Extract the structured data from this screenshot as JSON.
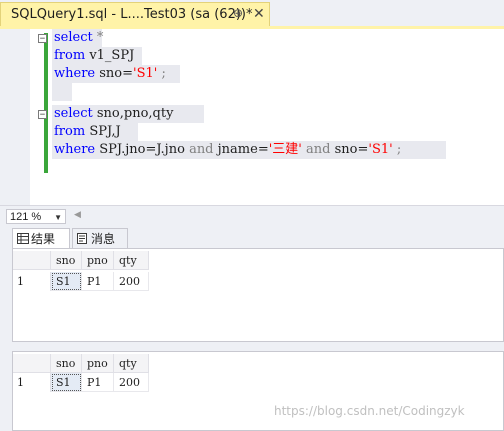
{
  "tab": {
    "title": "SQLQuery1.sql - L....Test03 (sa (62))*",
    "pin_glyph": "⊕",
    "close_glyph": "✕"
  },
  "editor": {
    "lines": [
      {
        "parts": [
          "select",
          " *"
        ]
      },
      {
        "parts": [
          "from",
          " v1_SPJ"
        ]
      },
      {
        "parts": [
          "where",
          " sno=",
          "'S1'",
          " ;"
        ]
      },
      {
        "parts": [
          "select",
          " sno,pno,qty"
        ]
      },
      {
        "parts": [
          "from",
          " SPJ,J"
        ]
      },
      {
        "parts": [
          "where",
          " SPJ.jno=J.jno ",
          "and",
          " jname=",
          "'三建'",
          " ",
          "and",
          " sno=",
          "'S1'",
          " ;"
        ]
      }
    ]
  },
  "zoom": {
    "value": "121 %"
  },
  "results_tabs": {
    "results": "结果",
    "messages": "消息"
  },
  "grids": [
    {
      "columns": [
        "sno",
        "pno",
        "qty"
      ],
      "rows": [
        {
          "num": "1",
          "cells": [
            "S1",
            "P1",
            "200"
          ]
        }
      ]
    },
    {
      "columns": [
        "sno",
        "pno",
        "qty"
      ],
      "rows": [
        {
          "num": "1",
          "cells": [
            "S1",
            "P1",
            "200"
          ]
        }
      ]
    }
  ],
  "watermark": "https://blog.csdn.net/Codingzyk",
  "colors": {
    "keyword": "#0000ff",
    "string": "#ff0000",
    "operator": "#808080",
    "tab_active": "#fff3a8",
    "change_bar": "#3aa63a"
  },
  "icons": {
    "results": "grid-icon",
    "messages": "message-icon",
    "fold": "collapse-icon"
  }
}
